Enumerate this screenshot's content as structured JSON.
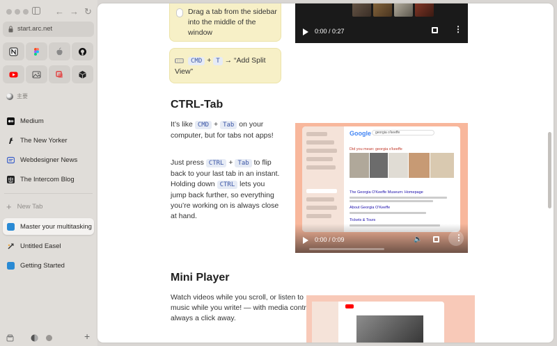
{
  "browser": {
    "url": "start.arc.net",
    "space_label": "主要",
    "favorites": [
      {
        "name": "notion-icon",
        "color": "#111111"
      },
      {
        "name": "figma-icon",
        "color": "#f24e1e"
      },
      {
        "name": "apple-icon",
        "color": "#8a8a8a"
      },
      {
        "name": "github-icon",
        "color": "#111111"
      },
      {
        "name": "youtube-icon",
        "color": "#ff0000"
      },
      {
        "name": "photos-icon",
        "color": "#555555"
      },
      {
        "name": "layers-icon",
        "color": "#e34040"
      },
      {
        "name": "cube-icon",
        "color": "#222222"
      }
    ],
    "pinned": [
      {
        "label": "Medium",
        "icon": "medium-icon"
      },
      {
        "label": "The New Yorker",
        "icon": "new-yorker-icon"
      },
      {
        "label": "Webdesigner News",
        "icon": "webdesigner-news-icon"
      },
      {
        "label": "The Intercom Blog",
        "icon": "intercom-icon"
      }
    ],
    "new_tab_label": "New Tab",
    "tabs": [
      {
        "label": "Master your multitasking",
        "active": true,
        "icon": "arc-doc-icon"
      },
      {
        "label": "Untitled Easel",
        "active": false,
        "icon": "easel-icon"
      },
      {
        "label": "Getting Started",
        "active": false,
        "icon": "arc-doc-icon"
      }
    ]
  },
  "page": {
    "tip1": "Drag a tab from the sidebar into the middle of the window",
    "tip2": {
      "key1": "CMD",
      "plus": "+",
      "key2": "T",
      "rest": "→ “Add Split View”"
    },
    "section1": {
      "heading": "CTRL-Tab",
      "p1_a": "It’s like",
      "p1_k1": "CMD",
      "p1_plus": "+",
      "p1_k2": "Tab",
      "p1_b": "on your computer, but for tabs not apps!",
      "p2_a": "Just press",
      "p2_k1": "CTRL",
      "p2_plus": "+",
      "p2_k2": "Tab",
      "p2_b": "to flip back to your last tab in an instant. Holding down",
      "p2_k3": "CTRL",
      "p2_c": "lets you jump back further, so everything you’re working on is always close at hand."
    },
    "section2": {
      "heading": "Mini Player",
      "p1": "Watch videos while you scroll, or listen to music while you write! — with media controls always a click away."
    },
    "video1": {
      "time": "0:00 / 0:27",
      "progress": 0.0
    },
    "video2": {
      "time": "0:00 / 0:09",
      "progress": 0.0
    },
    "google_demo": {
      "logo": "Google",
      "query": "georgia o'keeffe",
      "did_you_mean": "Did you mean: georgia o'keeffe",
      "result1": "The Georgia O'Keeffe Museum: Homepage",
      "result2": "About Georgia O'Keeffe",
      "result3": "Tickets & Tours"
    }
  },
  "colors": {
    "sidebar_bg": "#e0ddd9",
    "tip_bg": "#f7f0c7",
    "kbd_bg": "#e6ebf5",
    "kbd_text": "#3b56a6",
    "video_frame": "#f8b79c",
    "arc_blue": "#2a8ad4"
  }
}
